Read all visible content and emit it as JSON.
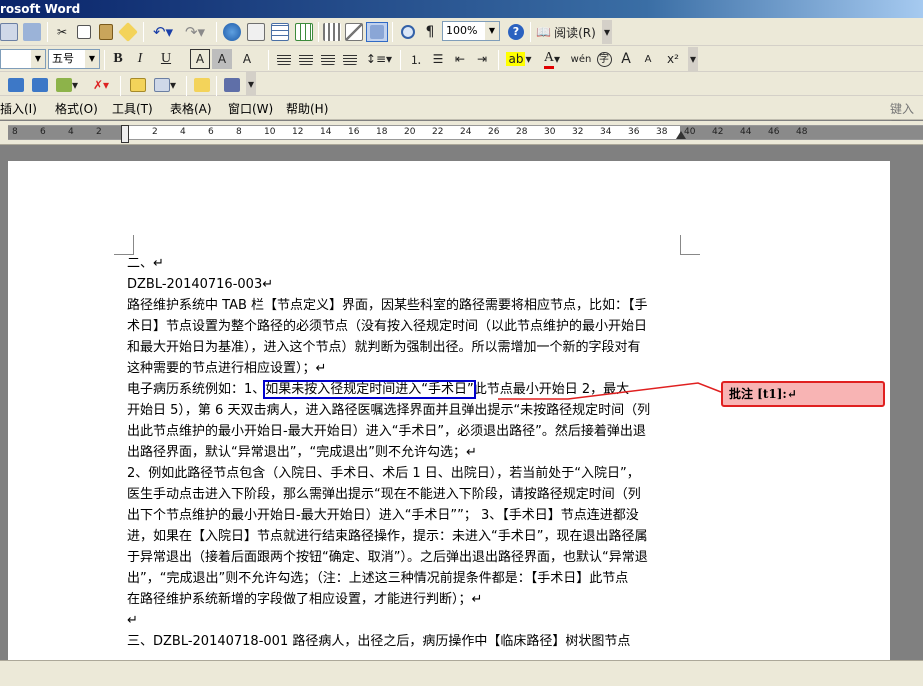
{
  "app": {
    "title": "rosoft Word"
  },
  "toolbar": {
    "zoom": "100%",
    "read_label": "阅读(R)",
    "font_size": "五号",
    "bold": "B",
    "italic": "I",
    "underline": "U",
    "char_border": "A",
    "char_shade": "A",
    "text_highlight": "A",
    "font_color": "A",
    "superscript_label": "x²",
    "grow_font": "A",
    "shrink_font": "A",
    "wen_label": "wén"
  },
  "menu": {
    "items": [
      "插入(I)",
      "格式(O)",
      "工具(T)",
      "表格(A)",
      "窗口(W)",
      "帮助(H)"
    ],
    "ask_placeholder": "键入需"
  },
  "ruler": {
    "labels": [
      "8",
      "6",
      "4",
      "2",
      "",
      "2",
      "4",
      "6",
      "8",
      "10",
      "12",
      "14",
      "16",
      "18",
      "20",
      "22",
      "24",
      "26",
      "28",
      "30",
      "32",
      "34",
      "36",
      "38",
      "40",
      "42",
      "44",
      "46",
      "48"
    ]
  },
  "document": {
    "lines": [
      "二、↵",
      "DZBL-20140716-003↵",
      "路径维护系统中 TAB 栏【节点定义】界面，因某些科室的路径需要将相应节点，比如：【手",
      "术日】节点设置为整个路径的必须节点（没有按入径规定时间（以此节点维护的最小开始日",
      "和最大开始日为基准），进入这个节点）就判断为强制出径。所以需增加一个新的字段对有",
      "这种需要的节点进行相应设置）；↵"
    ],
    "example_prefix": "电子病历系统例如：1、",
    "example_highlight": "如果未按入径规定时间进入“手术日”",
    "example_suffix": "此节点最小开始日 2，最大",
    "lines2": [
      "开始日 5），第 6 天双击病人，进入路径医嘱选择界面并且弹出提示“未按路径规定时间（列",
      "出此节点维护的最小开始日-最大开始日）进入“手术日”，必须退出路径”。然后接着弹出退",
      "出路径界面，默认“异常退出”，“完成退出”则不允许勾选；↵",
      "2、例如此路径节点包含（入院日、手术日、术后 1 日、出院日），若当前处于“入院日”，",
      "医生手动点击进入下阶段，那么需弹出提示“现在不能进入下阶段，请按路径规定时间（列",
      "出下个节点维护的最小开始日-最大开始日）进入“手术日””；  3、【手术日】节点连进都没",
      "进，如果在【入院日】节点就进行结束路径操作，提示：未进入“手术日”，现在退出路径属",
      "于异常退出（接着后面跟两个按钮“确定、取消”）。之后弹出退出路径界面，也默认“异常退",
      "出”，“完成退出”则不允许勾选；（注：上述这三种情况前提条件都是：【手术日】此节点",
      "在路径维护系统新增的字段做了相应设置，才能进行判断）；↵",
      "↵",
      "三、DZBL-20140718-001    路径病人，出径之后，病历操作中【临床路径】树状图节点"
    ],
    "comment": "批注 [t1]:↵"
  }
}
